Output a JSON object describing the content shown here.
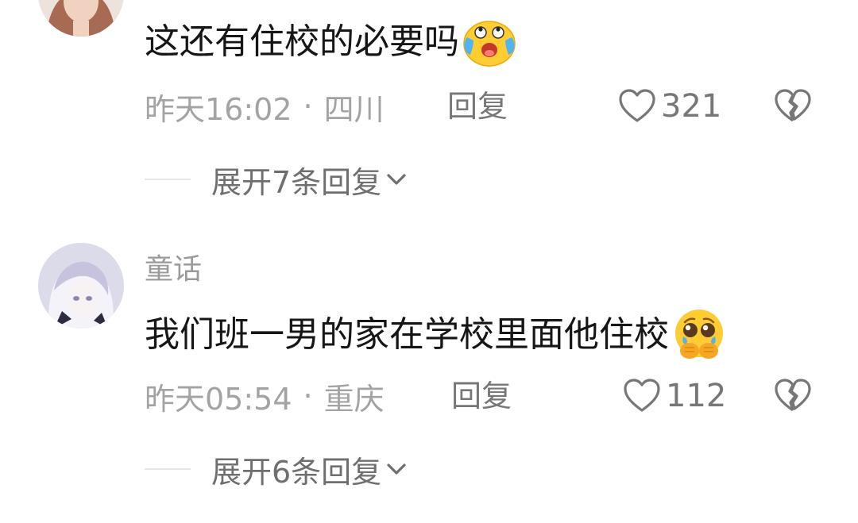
{
  "comments": [
    {
      "username": "",
      "text": "这还有住校的必要吗",
      "emoji": "crying-laughing-emoji",
      "time": "昨天16:02",
      "separator": "·",
      "location": "四川",
      "reply_label": "回复",
      "likes": "321",
      "expand_label": "展开7条回复"
    },
    {
      "username": "童话",
      "text": "我们班一男的家在学校里面他住校",
      "emoji": "pleading-crying-emoji",
      "time": "昨天05:54",
      "separator": "·",
      "location": "重庆",
      "reply_label": "回复",
      "likes": "112",
      "expand_label": "展开6条回复"
    }
  ],
  "icons": {
    "like": "heart-outline-icon",
    "dislike": "broken-heart-icon",
    "expand": "chevron-down-icon"
  },
  "colors": {
    "text_primary": "#161616",
    "text_secondary": "#a3a3a3",
    "action": "#777777",
    "emoji_yellow": "#ffcc33",
    "emoji_blue": "#4fb3f5"
  }
}
